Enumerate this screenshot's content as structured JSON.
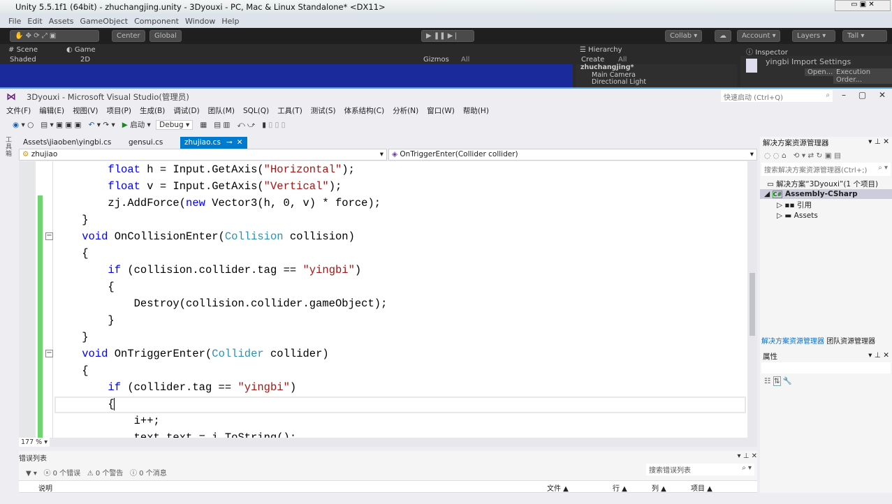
{
  "unity": {
    "title": "Unity 5.5.1f1 (64bit) - zhuchangjing.unity - 3Dyouxi - PC, Mac & Linux Standalone* <DX11>",
    "menu": [
      "File",
      "Edit",
      "Assets",
      "GameObject",
      "Component",
      "Window",
      "Help"
    ],
    "pivot": "Center",
    "space": "Global",
    "collab": "Collab ▾",
    "account": "Account",
    "layers": "Layers",
    "layout": "Tall",
    "tabs": {
      "scene": "Scene",
      "game": "Game",
      "hierarchy": "Hierarchy",
      "inspector": "Inspector"
    },
    "scene_bar": {
      "shading": "Shaded",
      "mode": "2D",
      "gizmos": "Gizmos",
      "search": "All"
    },
    "hierarchy": {
      "create": "Create",
      "search": "All",
      "scene": "zhuchangjing*",
      "items": [
        "Main Camera",
        "Directional Light"
      ]
    },
    "inspector": {
      "title": "yingbi Import Settings",
      "open": "Open...",
      "exec": "Execution Order..."
    }
  },
  "vs": {
    "title": "3Dyouxi - Microsoft Visual Studio(管理员)",
    "quick_launch": "快速启动 (Ctrl+Q)",
    "menu": [
      "文件(F)",
      "编辑(E)",
      "视图(V)",
      "项目(P)",
      "生成(B)",
      "调试(D)",
      "团队(M)",
      "SQL(Q)",
      "工具(T)",
      "测试(S)",
      "体系结构(C)",
      "分析(N)",
      "窗口(W)",
      "帮助(H)"
    ],
    "toolbar": {
      "start": "启动",
      "config": "Debug"
    },
    "tabs": [
      {
        "label": "Assets\\jiaoben\\yingbi.cs"
      },
      {
        "label": "gensui.cs"
      },
      {
        "label": "zhujiao.cs",
        "active": true
      }
    ],
    "nav": {
      "class": "zhujiao",
      "member": "OnTriggerEnter(Collider collider)"
    },
    "zoom": "177 %",
    "code": [
      [
        [
          "        "
        ],
        [
          "float",
          "k"
        ],
        [
          " h = Input.GetAxis("
        ],
        [
          "\"Horizontal\"",
          "s"
        ],
        [
          ");"
        ]
      ],
      [
        [
          "        "
        ],
        [
          "float",
          "k"
        ],
        [
          " v = Input.GetAxis("
        ],
        [
          "\"Vertical\"",
          "s"
        ],
        [
          ");"
        ]
      ],
      [
        [
          "        zj.AddForce("
        ],
        [
          "new",
          "k"
        ],
        [
          " Vector3(h, 0, v) * force);"
        ]
      ],
      [
        [
          "    }"
        ]
      ],
      [
        [
          "    "
        ],
        [
          "void",
          "k"
        ],
        [
          " OnCollisionEnter("
        ],
        [
          "Collision",
          "t"
        ],
        [
          " collision)"
        ]
      ],
      [
        [
          "    {"
        ]
      ],
      [
        [
          "        "
        ],
        [
          "if",
          "k"
        ],
        [
          " (collision.collider.tag == "
        ],
        [
          "\"yingbi\"",
          "s"
        ],
        [
          ")"
        ]
      ],
      [
        [
          "        {"
        ]
      ],
      [
        [
          "            Destroy(collision.collider.gameObject);"
        ]
      ],
      [
        [
          "        }"
        ]
      ],
      [
        [
          "    }"
        ]
      ],
      [
        [
          "    "
        ],
        [
          "void",
          "k"
        ],
        [
          " OnTriggerEnter("
        ],
        [
          "Collider",
          "t"
        ],
        [
          " collider)"
        ]
      ],
      [
        [
          "    {"
        ]
      ],
      [
        [
          "        "
        ],
        [
          "if",
          "k"
        ],
        [
          " (collider.tag == "
        ],
        [
          "\"yingbi\"",
          "s"
        ],
        [
          ")"
        ]
      ],
      [
        [
          "        {"
        ]
      ],
      [
        [
          "            i++;"
        ]
      ],
      [
        [
          "            text.text = i.ToString();"
        ]
      ]
    ],
    "error_list": {
      "title": "错误列表",
      "errors": "0 个错误",
      "warnings": "0 个警告",
      "messages": "0 个消息",
      "search": "搜索错误列表",
      "columns": [
        "说明",
        "文件",
        "行",
        "列",
        "项目"
      ]
    },
    "solution_explorer": {
      "title": "解决方案资源管理器",
      "search": "搜索解决方案资源管理器(Ctrl+;)",
      "solution": "解决方案“3Dyouxi”(1 个项目)",
      "project": "Assembly-CSharp",
      "children": [
        "引用",
        "Assets"
      ],
      "tabs": [
        "解决方案资源管理器",
        "团队资源管理器"
      ]
    },
    "properties": {
      "title": "属性"
    }
  },
  "colors": {
    "accent": "#007acc",
    "keyword": "#0000ff",
    "type": "#2b91af",
    "string": "#a31515",
    "change_bar": "#6fd36f"
  }
}
